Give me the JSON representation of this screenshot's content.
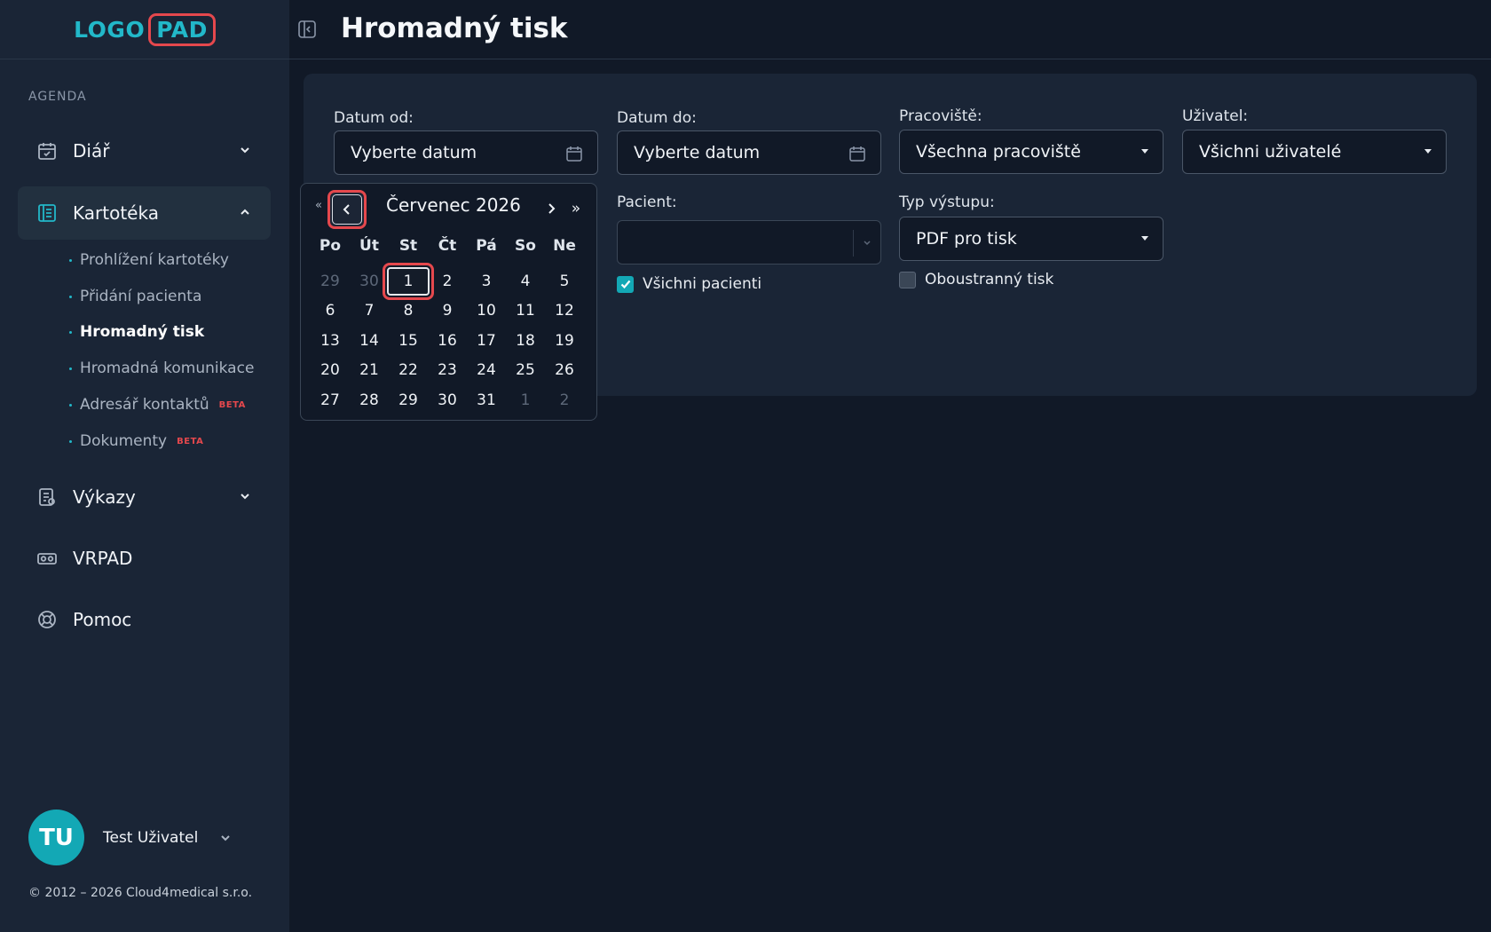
{
  "logo": {
    "part1": "LOGO",
    "part2": "PAD"
  },
  "sidebar": {
    "section_label": "AGENDA",
    "items": [
      {
        "label": "Diář",
        "icon": "calendar-icon"
      },
      {
        "label": "Kartotéka",
        "icon": "file-cabinet-icon"
      },
      {
        "label": "Výkazy",
        "icon": "report-icon"
      },
      {
        "label": "VRPAD",
        "icon": "vr-headset-icon"
      },
      {
        "label": "Pomoc",
        "icon": "lifebuoy-icon"
      }
    ],
    "subitems": [
      {
        "label": "Prohlížení kartotéky"
      },
      {
        "label": "Přidání pacienta"
      },
      {
        "label": "Hromadný tisk"
      },
      {
        "label": "Hromadná komunikace"
      },
      {
        "label": "Adresář kontaktů",
        "badge": "BETA"
      },
      {
        "label": "Dokumenty",
        "badge": "BETA"
      }
    ],
    "user": {
      "initials": "TU",
      "name": "Test Uživatel"
    },
    "copyright": "© 2012 – 2026 Cloud4medical s.r.o."
  },
  "header": {
    "title": "Hromadný tisk"
  },
  "form": {
    "date_from": {
      "label": "Datum od:",
      "placeholder": "Vyberte datum"
    },
    "date_to": {
      "label": "Datum do:",
      "placeholder": "Vyberte datum"
    },
    "workplace": {
      "label": "Pracoviště:",
      "value": "Všechna pracoviště"
    },
    "user": {
      "label": "Uživatel:",
      "value": "Všichni uživatelé"
    },
    "patient": {
      "label": "Pacient:",
      "value": ""
    },
    "output_type": {
      "label": "Typ výstupu:",
      "value": "PDF pro tisk"
    },
    "all_patients": {
      "label": "Všichni pacienti",
      "checked": true
    },
    "duplex": {
      "label": "Oboustranný tisk",
      "checked": false
    }
  },
  "calendar": {
    "title": "Červenec 2026",
    "dprev": "«",
    "dnext": "»",
    "weekdays": [
      "Po",
      "Út",
      "St",
      "Čt",
      "Pá",
      "So",
      "Ne"
    ],
    "weeks": [
      [
        "29",
        "30",
        "1",
        "2",
        "3",
        "4",
        "5"
      ],
      [
        "6",
        "7",
        "8",
        "9",
        "10",
        "11",
        "12"
      ],
      [
        "13",
        "14",
        "15",
        "16",
        "17",
        "18",
        "19"
      ],
      [
        "20",
        "21",
        "22",
        "23",
        "24",
        "25",
        "26"
      ],
      [
        "27",
        "28",
        "29",
        "30",
        "31",
        "1",
        "2"
      ]
    ],
    "today": "1"
  },
  "colors": {
    "accent": "#13a8b5",
    "highlight": "#e5484d",
    "background": "#111927",
    "panel": "#1a2536"
  }
}
